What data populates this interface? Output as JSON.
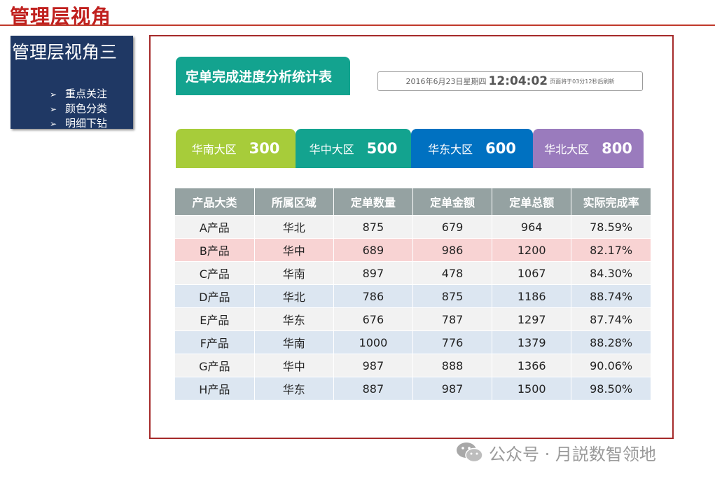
{
  "page": {
    "title": "管理层视角"
  },
  "sidebar": {
    "title": "管理层视角三",
    "items": [
      {
        "bullet": "➢",
        "label": "重点关注"
      },
      {
        "bullet": "➢",
        "label": "颜色分类"
      },
      {
        "bullet": "➢",
        "label": "明细下钻"
      }
    ]
  },
  "report": {
    "title": "定单完成进度分析统计表",
    "date": "2016年6月23日星期四",
    "time": "12:04:02",
    "refresh": "页面将于03分12秒后刷新"
  },
  "regions": [
    {
      "name": "华南大区",
      "value": "300",
      "color": "#a7cc3a"
    },
    {
      "name": "华中大区",
      "value": "500",
      "color": "#13a38f"
    },
    {
      "name": "华东大区",
      "value": "600",
      "color": "#0071c1"
    },
    {
      "name": "华北大区",
      "value": "800",
      "color": "#9a7bbd"
    }
  ],
  "table": {
    "headers": [
      "产品大类",
      "所属区域",
      "定单数量",
      "定单金额",
      "定单总额",
      "实际完成率"
    ],
    "rows": [
      [
        "A产品",
        "华北",
        "875",
        "679",
        "964",
        "78.59%"
      ],
      [
        "B产品",
        "华中",
        "689",
        "986",
        "1200",
        "82.17%"
      ],
      [
        "C产品",
        "华南",
        "897",
        "478",
        "1067",
        "84.30%"
      ],
      [
        "D产品",
        "华北",
        "786",
        "875",
        "1186",
        "88.74%"
      ],
      [
        "E产品",
        "华东",
        "676",
        "787",
        "1297",
        "87.74%"
      ],
      [
        "F产品",
        "华南",
        "1000",
        "776",
        "1379",
        "88.28%"
      ],
      [
        "G产品",
        "华中",
        "987",
        "888",
        "1366",
        "90.06%"
      ],
      [
        "H产品",
        "华东",
        "887",
        "987",
        "1500",
        "98.50%"
      ]
    ],
    "highlight_row": 1
  },
  "watermark": {
    "text": "公众号 · 月説数智领地",
    "icon": "wechat-icon"
  }
}
